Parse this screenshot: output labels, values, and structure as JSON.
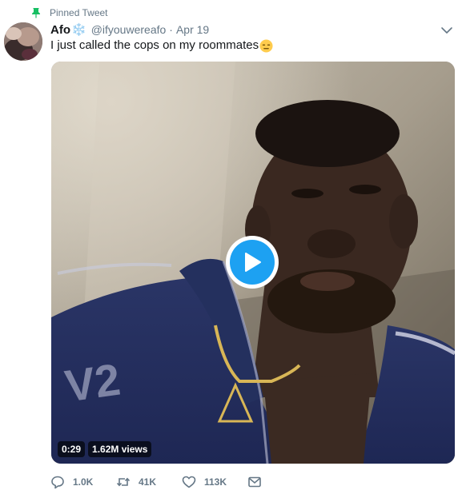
{
  "pinned": {
    "label": "Pinned Tweet",
    "icon": "pin-icon"
  },
  "author": {
    "name": "Afo",
    "name_emoji": "❄️",
    "handle": "@ifyouwereafo",
    "separator": "·",
    "date": "Apr 19"
  },
  "tweet": {
    "text": "I just called the cops on my roommates",
    "emoji": "expressionless-face-emoji"
  },
  "media": {
    "duration": "0:29",
    "views": "1.62M views"
  },
  "actions": {
    "replies": "1.0K",
    "retweets": "41K",
    "likes": "113K"
  },
  "colors": {
    "accent": "#1da1f2",
    "secondary_text": "#657786",
    "primary_text": "#14171a"
  }
}
